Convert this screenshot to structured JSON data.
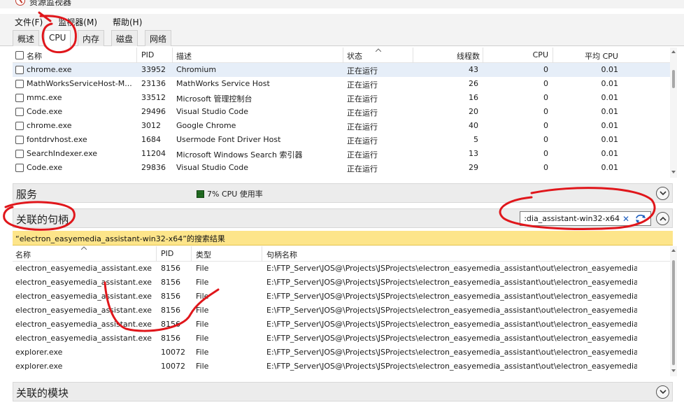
{
  "window": {
    "title": "资源监视器"
  },
  "menu": [
    "文件(F)",
    "监视器(M)",
    "帮助(H)"
  ],
  "tabs": [
    {
      "label": "概述",
      "active": false
    },
    {
      "label": "CPU",
      "active": true
    },
    {
      "label": "内存",
      "active": false
    },
    {
      "label": "磁盘",
      "active": false
    },
    {
      "label": "网络",
      "active": false
    }
  ],
  "processes": {
    "columns": [
      "名称",
      "PID",
      "描述",
      "状态",
      "线程数",
      "CPU",
      "平均 CPU"
    ],
    "rows": [
      {
        "name": "chrome.exe",
        "pid": "33952",
        "desc": "Chromium",
        "status": "正在运行",
        "threads": "43",
        "cpu": "0",
        "avg": "0.01",
        "selected": true
      },
      {
        "name": "MathWorksServiceHost-M...",
        "pid": "23136",
        "desc": "MathWorks Service Host",
        "status": "正在运行",
        "threads": "26",
        "cpu": "0",
        "avg": "0.01"
      },
      {
        "name": "mmc.exe",
        "pid": "33512",
        "desc": "Microsoft 管理控制台",
        "status": "正在运行",
        "threads": "16",
        "cpu": "0",
        "avg": "0.01"
      },
      {
        "name": "Code.exe",
        "pid": "29496",
        "desc": "Visual Studio Code",
        "status": "正在运行",
        "threads": "20",
        "cpu": "0",
        "avg": "0.01"
      },
      {
        "name": "chrome.exe",
        "pid": "3012",
        "desc": "Google Chrome",
        "status": "正在运行",
        "threads": "40",
        "cpu": "0",
        "avg": "0.01"
      },
      {
        "name": "fontdrvhost.exe",
        "pid": "1684",
        "desc": "Usermode Font Driver Host",
        "status": "正在运行",
        "threads": "5",
        "cpu": "0",
        "avg": "0.01"
      },
      {
        "name": "SearchIndexer.exe",
        "pid": "11204",
        "desc": "Microsoft Windows Search 索引器",
        "status": "正在运行",
        "threads": "13",
        "cpu": "0",
        "avg": "0.01"
      },
      {
        "name": "Code.exe",
        "pid": "29836",
        "desc": "Visual Studio Code",
        "status": "正在运行",
        "threads": "29",
        "cpu": "0",
        "avg": "0.01"
      }
    ]
  },
  "services": {
    "title": "服务",
    "cpu_usage": "7% CPU 使用率"
  },
  "handles": {
    "title": "关联的句柄",
    "search_value": ":dia_assistant-win32-x64",
    "banner": "“electron_easyemedia_assistant-win32-x64”的搜索结果",
    "columns": [
      "名称",
      "PID",
      "类型",
      "句柄名称"
    ],
    "rows": [
      {
        "name": "electron_easyemedia_assistant.exe",
        "pid": "8156",
        "type": "File",
        "handle": "E:\\FTP_Server\\JOS@\\Projects\\JSProjects\\electron_easyemedia_assistant\\out\\electron_easyemedia_a..."
      },
      {
        "name": "electron_easyemedia_assistant.exe",
        "pid": "8156",
        "type": "File",
        "handle": "E:\\FTP_Server\\JOS@\\Projects\\JSProjects\\electron_easyemedia_assistant\\out\\electron_easyemedia_a..."
      },
      {
        "name": "electron_easyemedia_assistant.exe",
        "pid": "8156",
        "type": "File",
        "handle": "E:\\FTP_Server\\JOS@\\Projects\\JSProjects\\electron_easyemedia_assistant\\out\\electron_easyemedia_a..."
      },
      {
        "name": "electron_easyemedia_assistant.exe",
        "pid": "8156",
        "type": "File",
        "handle": "E:\\FTP_Server\\JOS@\\Projects\\JSProjects\\electron_easyemedia_assistant\\out\\electron_easyemedia_a..."
      },
      {
        "name": "electron_easyemedia_assistant.exe",
        "pid": "8156",
        "type": "File",
        "handle": "E:\\FTP_Server\\JOS@\\Projects\\JSProjects\\electron_easyemedia_assistant\\out\\electron_easyemedia_a..."
      },
      {
        "name": "electron_easyemedia_assistant.exe",
        "pid": "8156",
        "type": "File",
        "handle": "E:\\FTP_Server\\JOS@\\Projects\\JSProjects\\electron_easyemedia_assistant\\out\\electron_easyemedia_a..."
      },
      {
        "name": "explorer.exe",
        "pid": "10072",
        "type": "File",
        "handle": "E:\\FTP_Server\\JOS@\\Projects\\JSProjects\\electron_easyemedia_assistant\\out\\electron_easyemedia_a..."
      },
      {
        "name": "explorer.exe",
        "pid": "10072",
        "type": "File",
        "handle": "E:\\FTP_Server\\JOS@\\Projects\\JSProjects\\electron_easyemedia_assistant\\out\\electron_easyemedia_a..."
      }
    ]
  },
  "modules": {
    "title": "关联的模块"
  },
  "icons": {
    "app": "resource-monitor-icon",
    "collapse": "chevron-icon",
    "clear": "clear-search-icon",
    "refresh": "refresh-icon",
    "cpu_meter": "cpu-meter-icon"
  },
  "colors": {
    "annotation": "#e0161b",
    "banner": "#fde58a",
    "selection": "#e6eef8",
    "link_blue": "#1f5fbf"
  }
}
